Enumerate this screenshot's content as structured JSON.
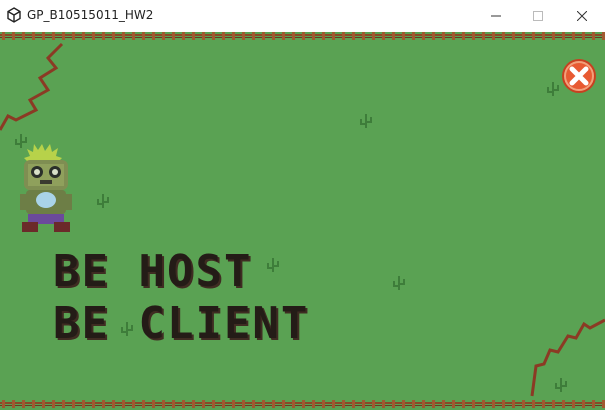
{
  "window": {
    "title": "GP_B10515011_HW2",
    "icon": "unity-logo-icon"
  },
  "menu": {
    "host_label": "BE HOST",
    "client_label": "BE CLIENT"
  },
  "colors": {
    "grass": "#5aa253",
    "text": "#241c17",
    "close_button": "#e85a32"
  }
}
